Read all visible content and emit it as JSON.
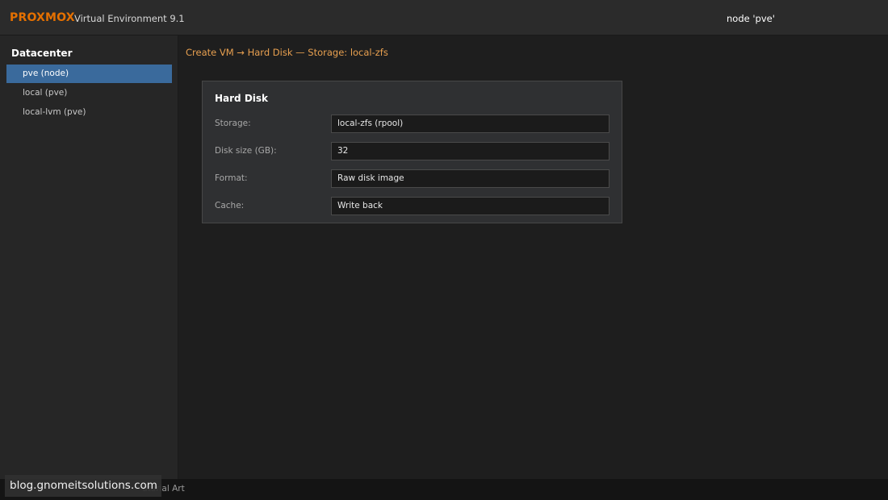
{
  "header": {
    "brand": "PROXMOX",
    "version_label": "Virtual Environment 9.1",
    "node_label": "node 'pve'"
  },
  "sidebar": {
    "title": "Datacenter",
    "items": [
      {
        "label": "pve (node)",
        "selected": true
      },
      {
        "label": "local (pve)",
        "selected": false
      },
      {
        "label": "local-lvm (pve)",
        "selected": false
      }
    ]
  },
  "main": {
    "breadcrumb": "Create VM → Hard Disk — Storage: local-zfs",
    "panel": {
      "title": "Hard Disk",
      "fields": [
        {
          "label": "Storage:",
          "value": "local-zfs (rpool)"
        },
        {
          "label": "Disk size (GB):",
          "value": "32"
        },
        {
          "label": "Format:",
          "value": "Raw disk image"
        },
        {
          "label": "Cache:",
          "value": "Write back"
        }
      ]
    }
  },
  "footer": {
    "text": "utorial Art"
  },
  "watermark": {
    "text": "blog.gnomeitsolutions.com"
  },
  "colors": {
    "brand": "#e57000",
    "selected": "#3a6a9c",
    "breadcrumb": "#e8a050"
  }
}
